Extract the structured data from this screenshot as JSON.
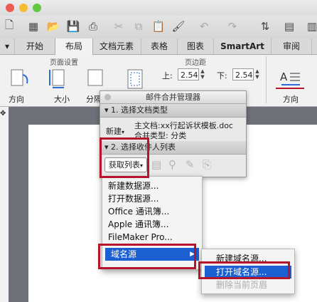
{
  "tabs": [
    "开始",
    "布局",
    "文档元素",
    "表格",
    "图表",
    "SmartArt",
    "审阅"
  ],
  "active_tab": "布局",
  "ribbon": {
    "group_page_setup": "页面设置",
    "group_margins": "页边距",
    "orientation_label": "方向",
    "size_label": "大小",
    "columns_label": "分隔",
    "top_label": "上:",
    "top_value": "2.54",
    "bottom_label": "下:",
    "bottom_value": "2.54",
    "text_direction_label": "方向"
  },
  "panel": {
    "title": "邮件合并管理器",
    "section1_title": "1. 选择文档类型",
    "new_label": "新建",
    "main_doc": "主文档:xx行起诉状模板.doc",
    "merge_type": "合并类型: 分类",
    "section2_title": "2. 选择收件人列表",
    "get_list_button": "获取列表"
  },
  "list_menu": {
    "items": [
      "新建数据源...",
      "打开数据源...",
      "Office 通讯簿...",
      "Apple 通讯簿...",
      "FileMaker Pro..."
    ],
    "domain_source": "域名源"
  },
  "submenu": {
    "items": [
      "新建域名源...",
      "打开域名源...",
      "删除当前页眉"
    ]
  },
  "colors": {
    "highlight": "#1b5fd1",
    "annotation": "#b5152b"
  }
}
